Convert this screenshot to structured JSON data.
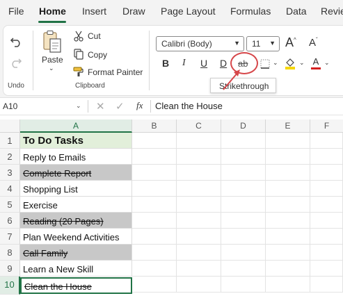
{
  "menu": {
    "tabs": [
      "File",
      "Home",
      "Insert",
      "Draw",
      "Page Layout",
      "Formulas",
      "Data",
      "Revie"
    ],
    "active": "Home"
  },
  "ribbon": {
    "undo_group": {
      "label": "Undo"
    },
    "clipboard": {
      "label": "Clipboard",
      "paste_label": "Paste",
      "cut_label": "Cut",
      "copy_label": "Copy",
      "format_painter_label": "Format Painter"
    },
    "font": {
      "family": "Calibri (Body)",
      "size": "11",
      "bold": "B",
      "italic": "I",
      "underline": "U",
      "double_underline": "D",
      "strike_glyph": "ab",
      "grow_font": "A",
      "shrink_font": "A",
      "font_color_glyph": "A",
      "highlight_color": "#f6d700",
      "font_color": "#d42020"
    },
    "tooltip": "Strikethrough"
  },
  "formula_bar": {
    "name_box": "A10",
    "fx": "fx",
    "value": "Clean the House"
  },
  "sheet": {
    "columns": [
      "A",
      "B",
      "C",
      "D",
      "E",
      "F"
    ],
    "selected_column": "A",
    "rows": [
      {
        "num": "1",
        "text": "To Do Tasks",
        "style": "header"
      },
      {
        "num": "2",
        "text": "Reply to Emails",
        "style": "normal"
      },
      {
        "num": "3",
        "text": "Complete Report",
        "style": "done"
      },
      {
        "num": "4",
        "text": "Shopping List",
        "style": "normal"
      },
      {
        "num": "5",
        "text": "Exercise",
        "style": "normal"
      },
      {
        "num": "6",
        "text": "Reading (20 Pages)",
        "style": "done"
      },
      {
        "num": "7",
        "text": "Plan Weekend Activities",
        "style": "normal"
      },
      {
        "num": "8",
        "text": "Call Family",
        "style": "done"
      },
      {
        "num": "9",
        "text": "Learn a New Skill",
        "style": "normal"
      },
      {
        "num": "10",
        "text": "Clean the House",
        "style": "active"
      }
    ]
  },
  "colors": {
    "accent": "#217346",
    "annotation": "#d6474a",
    "done_fill": "#c8c8c8",
    "header_fill": "#e2efda"
  }
}
